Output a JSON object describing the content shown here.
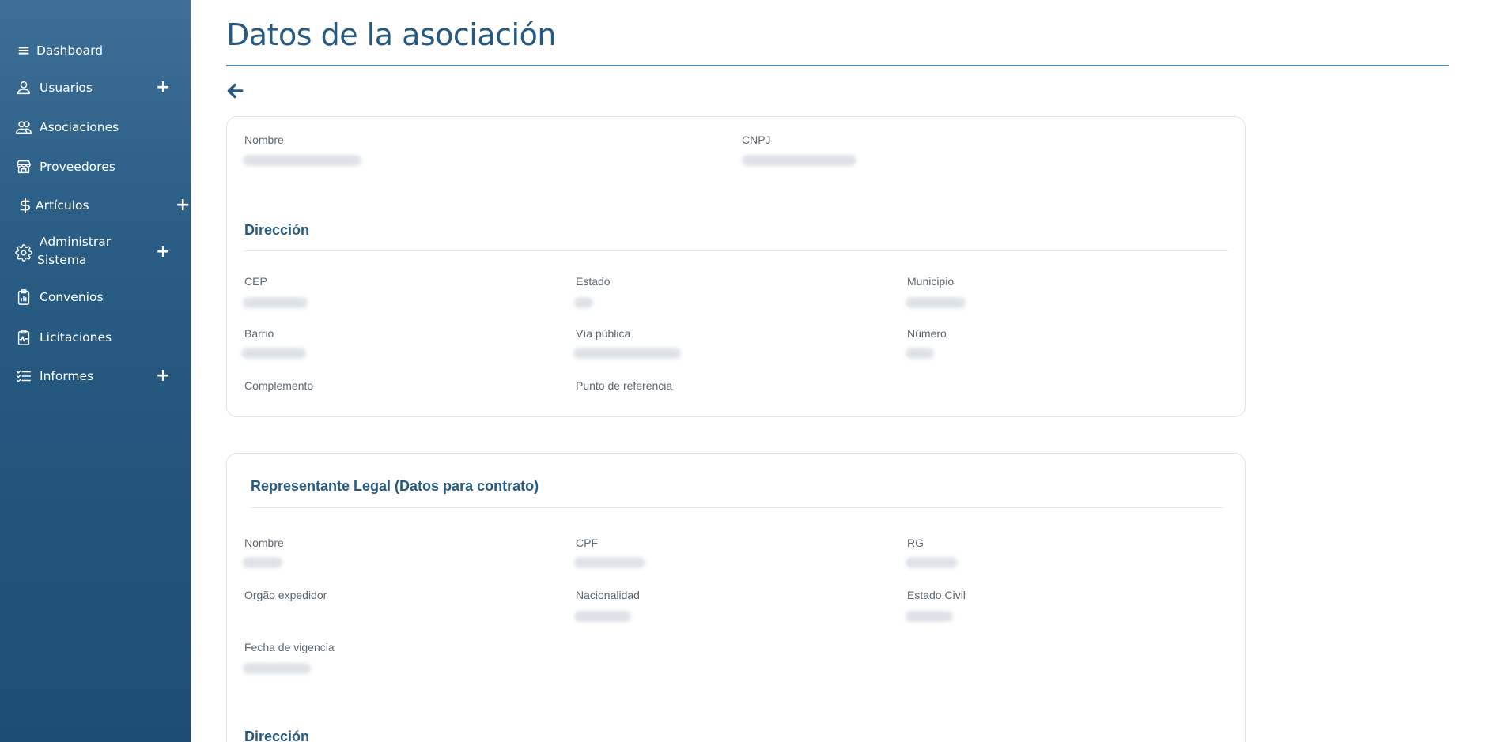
{
  "sidebar": {
    "items": [
      {
        "label": "Dashboard",
        "icon": "menu-icon",
        "expandable": false
      },
      {
        "label": "Usuarios",
        "icon": "user-icon",
        "expandable": true
      },
      {
        "label": "Asociaciones",
        "icon": "users-icon",
        "expandable": false
      },
      {
        "label": "Proveedores",
        "icon": "store-icon",
        "expandable": false
      },
      {
        "label": "Artículos",
        "icon": "dollar-icon",
        "expandable": true
      },
      {
        "label": "Administrar",
        "label2": "Sistema",
        "icon": "gear-icon",
        "expandable": true
      },
      {
        "label": "Convenios",
        "icon": "clipboard-chart-icon",
        "expandable": false
      },
      {
        "label": "Licitaciones",
        "icon": "clipboard-pulse-icon",
        "expandable": false
      },
      {
        "label": "Informes",
        "icon": "list-check-icon",
        "expandable": true
      }
    ],
    "plus_symbol": "+"
  },
  "page": {
    "title": "Datos de la asociación"
  },
  "association_card": {
    "nombre_label": "Nombre",
    "cnpj_label": "CNPJ",
    "address_title": "Dirección",
    "cep_label": "CEP",
    "estado_label": "Estado",
    "municipio_label": "Municipio",
    "barrio_label": "Barrio",
    "via_label": "Vía pública",
    "numero_label": "Número",
    "complemento_label": "Complemento",
    "referencia_label": "Punto de referencia"
  },
  "representative_card": {
    "title": "Representante Legal (Datos para contrato)",
    "nombre_label": "Nombre",
    "cpf_label": "CPF",
    "rg_label": "RG",
    "organo_label": "Orgão expedidor",
    "nacionalidad_label": "Nacionalidad",
    "estado_civil_label": "Estado Civil",
    "fecha_label": "Fecha de vigencia",
    "address_title": "Dirección"
  },
  "colors": {
    "accent": "#265a82",
    "sidebar_top": "#3d6e96",
    "sidebar_bottom": "#1d4d72"
  }
}
